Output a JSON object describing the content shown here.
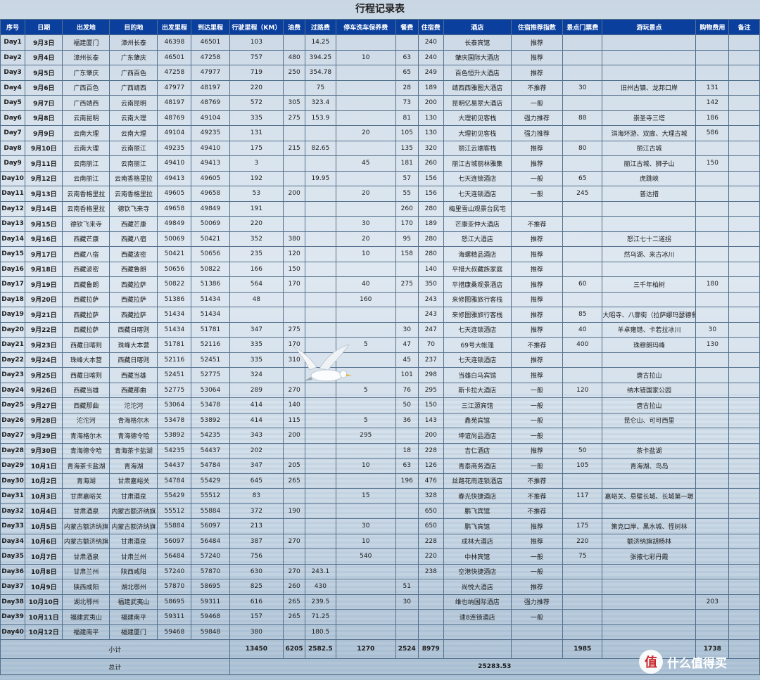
{
  "title": "行程记录表",
  "headers": [
    "序号",
    "日期",
    "出发地",
    "目的地",
    "出发里程",
    "到达里程",
    "行驶里程（KM）",
    "油费",
    "过路费",
    "停车洗车保养费",
    "餐费",
    "住宿费",
    "酒店",
    "住宿推荐指数",
    "景点门票费",
    "游玩景点",
    "购物费用",
    "备注"
  ],
  "rows": [
    [
      "Day1",
      "9月3日",
      "福建厦门",
      "漳州长泰",
      "46398",
      "46501",
      "103",
      "",
      "14.25",
      "",
      "",
      "240",
      "长泰宾馆",
      "推荐",
      "",
      "",
      "",
      ""
    ],
    [
      "Day2",
      "9月4日",
      "漳州长泰",
      "广东肇庆",
      "46501",
      "47258",
      "757",
      "480",
      "394.25",
      "10",
      "63",
      "240",
      "肇庆国际大酒店",
      "推荐",
      "",
      "",
      "",
      ""
    ],
    [
      "Day3",
      "9月5日",
      "广东肇庆",
      "广西百色",
      "47258",
      "47977",
      "719",
      "250",
      "354.78",
      "",
      "65",
      "249",
      "百色恒升大酒店",
      "推荐",
      "",
      "",
      "",
      ""
    ],
    [
      "Day4",
      "9月6日",
      "广西百色",
      "广西靖西",
      "47977",
      "48197",
      "220",
      "",
      "75",
      "",
      "28",
      "189",
      "靖西西雅图大酒店",
      "不推荐",
      "30",
      "旧州古镇、龙邦口岸",
      "131",
      ""
    ],
    [
      "Day5",
      "9月7日",
      "广西靖西",
      "云南昆明",
      "48197",
      "48769",
      "572",
      "305",
      "323.4",
      "",
      "73",
      "200",
      "昆明亿易翠大酒店",
      "一般",
      "",
      "",
      "142",
      ""
    ],
    [
      "Day6",
      "9月8日",
      "云南昆明",
      "云南大理",
      "48769",
      "49104",
      "335",
      "275",
      "153.9",
      "",
      "81",
      "130",
      "大理初见客栈",
      "强力推荐",
      "88",
      "崇圣寺三塔",
      "186",
      ""
    ],
    [
      "Day7",
      "9月9日",
      "云南大理",
      "云南大理",
      "49104",
      "49235",
      "131",
      "",
      "",
      "20",
      "105",
      "130",
      "大理初见客栈",
      "强力推荐",
      "",
      "洱海环游、双廊、大理古城",
      "586",
      ""
    ],
    [
      "Day8",
      "9月10日",
      "云南大理",
      "云南丽江",
      "49235",
      "49410",
      "175",
      "215",
      "82.65",
      "",
      "135",
      "320",
      "丽江云端客栈",
      "推荐",
      "80",
      "丽江古城",
      "",
      ""
    ],
    [
      "Day9",
      "9月11日",
      "云南丽江",
      "云南丽江",
      "49410",
      "49413",
      "3",
      "",
      "",
      "45",
      "181",
      "260",
      "丽江古城丽林雅集",
      "推荐",
      "",
      "丽江古城、狮子山",
      "150",
      ""
    ],
    [
      "Day10",
      "9月12日",
      "云南丽江",
      "云南香格里拉",
      "49413",
      "49605",
      "192",
      "",
      "19.95",
      "",
      "57",
      "156",
      "七天连锁酒店",
      "一般",
      "65",
      "虎跳峡",
      "",
      ""
    ],
    [
      "Day11",
      "9月13日",
      "云南香格里拉",
      "云南香格里拉",
      "49605",
      "49658",
      "53",
      "200",
      "",
      "20",
      "55",
      "156",
      "七天连锁酒店",
      "一般",
      "245",
      "普达措",
      "",
      ""
    ],
    [
      "Day12",
      "9月14日",
      "云南香格里拉",
      "德钦飞来寺",
      "49658",
      "49849",
      "191",
      "",
      "",
      "",
      "260",
      "280",
      "梅里雪山观景台民宅",
      "",
      "",
      "",
      "",
      ""
    ],
    [
      "Day13",
      "9月15日",
      "德钦飞来寺",
      "西藏芒康",
      "49849",
      "50069",
      "220",
      "",
      "",
      "30",
      "170",
      "189",
      "芒康亚仲大酒店",
      "不推荐",
      "",
      "",
      "",
      ""
    ],
    [
      "Day14",
      "9月16日",
      "西藏芒康",
      "西藏八宿",
      "50069",
      "50421",
      "352",
      "380",
      "",
      "20",
      "95",
      "280",
      "怒江大酒店",
      "推荐",
      "",
      "怒江七十二道拐",
      "",
      ""
    ],
    [
      "Day15",
      "9月17日",
      "西藏八宿",
      "西藏波密",
      "50421",
      "50656",
      "235",
      "120",
      "",
      "10",
      "158",
      "280",
      "海螺精品酒店",
      "推荐",
      "",
      "然乌湖、来古冰川",
      "",
      ""
    ],
    [
      "Day16",
      "9月18日",
      "西藏波密",
      "西藏鲁朗",
      "50656",
      "50822",
      "166",
      "150",
      "",
      "",
      "",
      "140",
      "平措大叔藏族家庭",
      "推荐",
      "",
      "",
      "",
      ""
    ],
    [
      "Day17",
      "9月19日",
      "西藏鲁朗",
      "西藏拉萨",
      "50822",
      "51386",
      "564",
      "170",
      "",
      "40",
      "275",
      "350",
      "平措康桑观景酒店",
      "推荐",
      "60",
      "三千年柏树",
      "180",
      ""
    ],
    [
      "Day18",
      "9月20日",
      "西藏拉萨",
      "西藏拉萨",
      "51386",
      "51434",
      "48",
      "",
      "",
      "160",
      "",
      "243",
      "来修图雅旅行客栈",
      "推荐",
      "",
      "",
      "",
      ""
    ],
    [
      "Day19",
      "9月21日",
      "西藏拉萨",
      "西藏拉萨",
      "51434",
      "51434",
      "",
      "",
      "",
      "",
      "",
      "243",
      "来修图雅旅行客栈",
      "推荐",
      "85",
      "大昭寺、八廓街（拉萨娜玛瑟德餐厅）",
      "",
      ""
    ],
    [
      "Day20",
      "9月22日",
      "西藏拉萨",
      "西藏日喀则",
      "51434",
      "51781",
      "347",
      "275",
      "",
      "",
      "30",
      "247",
      "七天连锁酒店",
      "推荐",
      "40",
      "羊卓雍错、卡若拉冰川",
      "30",
      ""
    ],
    [
      "Day21",
      "9月23日",
      "西藏日喀则",
      "珠峰大本营",
      "51781",
      "52116",
      "335",
      "170",
      "",
      "5",
      "47",
      "70",
      "69号大帐篷",
      "不推荐",
      "400",
      "珠穆朗玛峰",
      "130",
      ""
    ],
    [
      "Day22",
      "9月24日",
      "珠峰大本营",
      "西藏日喀则",
      "52116",
      "52451",
      "335",
      "310",
      "",
      "",
      "45",
      "237",
      "七天连锁酒店",
      "推荐",
      "",
      "",
      "",
      ""
    ],
    [
      "Day23",
      "9月25日",
      "西藏日喀则",
      "西藏当雄",
      "52451",
      "52775",
      "324",
      "",
      "",
      "",
      "101",
      "298",
      "当雄白马宾馆",
      "推荐",
      "",
      "唐古拉山",
      "",
      ""
    ],
    [
      "Day24",
      "9月26日",
      "西藏当雄",
      "西藏那曲",
      "52775",
      "53064",
      "289",
      "270",
      "",
      "5",
      "76",
      "295",
      "斯卡拉大酒店",
      "一般",
      "120",
      "纳木错国家公园",
      "",
      ""
    ],
    [
      "Day25",
      "9月27日",
      "西藏那曲",
      "沱沱河",
      "53064",
      "53478",
      "414",
      "140",
      "",
      "",
      "50",
      "150",
      "三江源宾馆",
      "一般",
      "",
      "唐古拉山",
      "",
      ""
    ],
    [
      "Day26",
      "9月28日",
      "沱沱河",
      "青海格尔木",
      "53478",
      "53892",
      "414",
      "115",
      "",
      "5",
      "36",
      "143",
      "鑫苑宾馆",
      "一般",
      "",
      "昆仑山、可可西里",
      "",
      ""
    ],
    [
      "Day27",
      "9月29日",
      "青海格尔木",
      "青海德令哈",
      "53892",
      "54235",
      "343",
      "200",
      "",
      "295",
      "",
      "200",
      "坤谊尚品酒店",
      "一般",
      "",
      "",
      "",
      ""
    ],
    [
      "Day28",
      "9月30日",
      "青海德令哈",
      "青海茶卡盐湖",
      "54235",
      "54437",
      "202",
      "",
      "",
      "",
      "18",
      "228",
      "吉仁酒店",
      "推荐",
      "50",
      "茶卡盐湖",
      "",
      ""
    ],
    [
      "Day29",
      "10月1日",
      "青海茶卡盐湖",
      "青海湖",
      "54437",
      "54784",
      "347",
      "205",
      "",
      "10",
      "63",
      "126",
      "青泰商务酒店",
      "一般",
      "105",
      "青海湖、鸟岛",
      "",
      ""
    ],
    [
      "Day30",
      "10月2日",
      "青海湖",
      "甘肃嘉峪关",
      "54784",
      "55429",
      "645",
      "265",
      "",
      "",
      "196",
      "476",
      "丝路花雨连锁酒店",
      "不推荐",
      "",
      "",
      "",
      ""
    ],
    [
      "Day31",
      "10月3日",
      "甘肃嘉峪关",
      "甘肃酒泉",
      "55429",
      "55512",
      "83",
      "",
      "",
      "15",
      "",
      "328",
      "春光快捷酒店",
      "不推荐",
      "117",
      "嘉峪关、悬壁长城、长城第一墩",
      "",
      ""
    ],
    [
      "Day32",
      "10月4日",
      "甘肃酒泉",
      "内蒙古额济纳旗",
      "55512",
      "55884",
      "372",
      "190",
      "",
      "",
      "",
      "650",
      "鹏飞宾馆",
      "不推荐",
      "",
      "",
      "",
      ""
    ],
    [
      "Day33",
      "10月5日",
      "内蒙古额济纳旗",
      "内蒙古额济纳旗",
      "55884",
      "56097",
      "213",
      "",
      "",
      "30",
      "",
      "650",
      "鹏飞宾馆",
      "推荐",
      "175",
      "策克口岸、黑水城、怪树林",
      "",
      ""
    ],
    [
      "Day34",
      "10月6日",
      "内蒙古额济纳旗",
      "甘肃酒泉",
      "56097",
      "56484",
      "387",
      "270",
      "",
      "10",
      "",
      "228",
      "成林大酒店",
      "推荐",
      "220",
      "额济纳旗胡杨林",
      "",
      ""
    ],
    [
      "Day35",
      "10月7日",
      "甘肃酒泉",
      "甘肃兰州",
      "56484",
      "57240",
      "756",
      "",
      "",
      "540",
      "",
      "220",
      "中林宾馆",
      "一般",
      "75",
      "张掖七彩丹霞",
      "",
      ""
    ],
    [
      "Day36",
      "10月8日",
      "甘肃兰州",
      "陕西咸阳",
      "57240",
      "57870",
      "630",
      "270",
      "243.1",
      "",
      "",
      "238",
      "空港快捷酒店",
      "一般",
      "",
      "",
      "",
      ""
    ],
    [
      "Day37",
      "10月9日",
      "陕西咸阳",
      "湖北鄂州",
      "57870",
      "58695",
      "825",
      "260",
      "430",
      "",
      "51",
      "",
      "尚悦大酒店",
      "推荐",
      "",
      "",
      "",
      ""
    ],
    [
      "Day38",
      "10月10日",
      "湖北鄂州",
      "福建武夷山",
      "58695",
      "59311",
      "616",
      "265",
      "239.5",
      "",
      "30",
      "",
      "维也纳国际酒店",
      "强力推荐",
      "",
      "",
      "203",
      ""
    ],
    [
      "Day39",
      "10月11日",
      "福建武夷山",
      "福建南平",
      "59311",
      "59468",
      "157",
      "265",
      "71.25",
      "",
      "",
      "",
      "速8连锁酒店",
      "一般",
      "",
      "",
      "",
      ""
    ],
    [
      "Day40",
      "10月12日",
      "福建南平",
      "福建厦门",
      "59468",
      "59848",
      "380",
      "",
      "180.5",
      "",
      "",
      "",
      "",
      "",
      "",
      "",
      "",
      ""
    ]
  ],
  "subtotal": {
    "label": "小计",
    "distance": "13450",
    "fuel": "6205",
    "toll": "2582.5",
    "parking": "1270",
    "meals": "2524",
    "lodging": "8979",
    "tickets": "1985",
    "shopping": "1738"
  },
  "total": {
    "label": "总计",
    "value": "25283.53"
  },
  "watermark": {
    "badge": "值",
    "text": "什么值得买"
  },
  "colors": {
    "header_bg": "#0a3f9e",
    "distance_total": "#c0203a",
    "totals": "#1a64c7"
  }
}
